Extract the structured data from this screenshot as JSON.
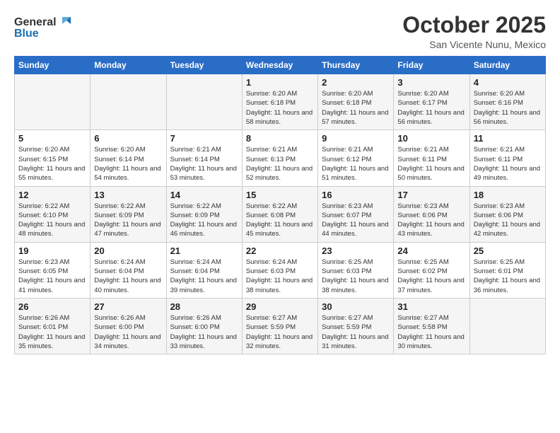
{
  "header": {
    "logo_line1": "General",
    "logo_line2": "Blue",
    "month": "October 2025",
    "location": "San Vicente Nunu, Mexico"
  },
  "weekdays": [
    "Sunday",
    "Monday",
    "Tuesday",
    "Wednesday",
    "Thursday",
    "Friday",
    "Saturday"
  ],
  "weeks": [
    [
      {
        "day": "",
        "sunrise": "",
        "sunset": "",
        "daylight": ""
      },
      {
        "day": "",
        "sunrise": "",
        "sunset": "",
        "daylight": ""
      },
      {
        "day": "",
        "sunrise": "",
        "sunset": "",
        "daylight": ""
      },
      {
        "day": "1",
        "sunrise": "Sunrise: 6:20 AM",
        "sunset": "Sunset: 6:18 PM",
        "daylight": "Daylight: 11 hours and 58 minutes."
      },
      {
        "day": "2",
        "sunrise": "Sunrise: 6:20 AM",
        "sunset": "Sunset: 6:18 PM",
        "daylight": "Daylight: 11 hours and 57 minutes."
      },
      {
        "day": "3",
        "sunrise": "Sunrise: 6:20 AM",
        "sunset": "Sunset: 6:17 PM",
        "daylight": "Daylight: 11 hours and 56 minutes."
      },
      {
        "day": "4",
        "sunrise": "Sunrise: 6:20 AM",
        "sunset": "Sunset: 6:16 PM",
        "daylight": "Daylight: 11 hours and 56 minutes."
      }
    ],
    [
      {
        "day": "5",
        "sunrise": "Sunrise: 6:20 AM",
        "sunset": "Sunset: 6:15 PM",
        "daylight": "Daylight: 11 hours and 55 minutes."
      },
      {
        "day": "6",
        "sunrise": "Sunrise: 6:20 AM",
        "sunset": "Sunset: 6:14 PM",
        "daylight": "Daylight: 11 hours and 54 minutes."
      },
      {
        "day": "7",
        "sunrise": "Sunrise: 6:21 AM",
        "sunset": "Sunset: 6:14 PM",
        "daylight": "Daylight: 11 hours and 53 minutes."
      },
      {
        "day": "8",
        "sunrise": "Sunrise: 6:21 AM",
        "sunset": "Sunset: 6:13 PM",
        "daylight": "Daylight: 11 hours and 52 minutes."
      },
      {
        "day": "9",
        "sunrise": "Sunrise: 6:21 AM",
        "sunset": "Sunset: 6:12 PM",
        "daylight": "Daylight: 11 hours and 51 minutes."
      },
      {
        "day": "10",
        "sunrise": "Sunrise: 6:21 AM",
        "sunset": "Sunset: 6:11 PM",
        "daylight": "Daylight: 11 hours and 50 minutes."
      },
      {
        "day": "11",
        "sunrise": "Sunrise: 6:21 AM",
        "sunset": "Sunset: 6:11 PM",
        "daylight": "Daylight: 11 hours and 49 minutes."
      }
    ],
    [
      {
        "day": "12",
        "sunrise": "Sunrise: 6:22 AM",
        "sunset": "Sunset: 6:10 PM",
        "daylight": "Daylight: 11 hours and 48 minutes."
      },
      {
        "day": "13",
        "sunrise": "Sunrise: 6:22 AM",
        "sunset": "Sunset: 6:09 PM",
        "daylight": "Daylight: 11 hours and 47 minutes."
      },
      {
        "day": "14",
        "sunrise": "Sunrise: 6:22 AM",
        "sunset": "Sunset: 6:09 PM",
        "daylight": "Daylight: 11 hours and 46 minutes."
      },
      {
        "day": "15",
        "sunrise": "Sunrise: 6:22 AM",
        "sunset": "Sunset: 6:08 PM",
        "daylight": "Daylight: 11 hours and 45 minutes."
      },
      {
        "day": "16",
        "sunrise": "Sunrise: 6:23 AM",
        "sunset": "Sunset: 6:07 PM",
        "daylight": "Daylight: 11 hours and 44 minutes."
      },
      {
        "day": "17",
        "sunrise": "Sunrise: 6:23 AM",
        "sunset": "Sunset: 6:06 PM",
        "daylight": "Daylight: 11 hours and 43 minutes."
      },
      {
        "day": "18",
        "sunrise": "Sunrise: 6:23 AM",
        "sunset": "Sunset: 6:06 PM",
        "daylight": "Daylight: 11 hours and 42 minutes."
      }
    ],
    [
      {
        "day": "19",
        "sunrise": "Sunrise: 6:23 AM",
        "sunset": "Sunset: 6:05 PM",
        "daylight": "Daylight: 11 hours and 41 minutes."
      },
      {
        "day": "20",
        "sunrise": "Sunrise: 6:24 AM",
        "sunset": "Sunset: 6:04 PM",
        "daylight": "Daylight: 11 hours and 40 minutes."
      },
      {
        "day": "21",
        "sunrise": "Sunrise: 6:24 AM",
        "sunset": "Sunset: 6:04 PM",
        "daylight": "Daylight: 11 hours and 39 minutes."
      },
      {
        "day": "22",
        "sunrise": "Sunrise: 6:24 AM",
        "sunset": "Sunset: 6:03 PM",
        "daylight": "Daylight: 11 hours and 38 minutes."
      },
      {
        "day": "23",
        "sunrise": "Sunrise: 6:25 AM",
        "sunset": "Sunset: 6:03 PM",
        "daylight": "Daylight: 11 hours and 38 minutes."
      },
      {
        "day": "24",
        "sunrise": "Sunrise: 6:25 AM",
        "sunset": "Sunset: 6:02 PM",
        "daylight": "Daylight: 11 hours and 37 minutes."
      },
      {
        "day": "25",
        "sunrise": "Sunrise: 6:25 AM",
        "sunset": "Sunset: 6:01 PM",
        "daylight": "Daylight: 11 hours and 36 minutes."
      }
    ],
    [
      {
        "day": "26",
        "sunrise": "Sunrise: 6:26 AM",
        "sunset": "Sunset: 6:01 PM",
        "daylight": "Daylight: 11 hours and 35 minutes."
      },
      {
        "day": "27",
        "sunrise": "Sunrise: 6:26 AM",
        "sunset": "Sunset: 6:00 PM",
        "daylight": "Daylight: 11 hours and 34 minutes."
      },
      {
        "day": "28",
        "sunrise": "Sunrise: 6:26 AM",
        "sunset": "Sunset: 6:00 PM",
        "daylight": "Daylight: 11 hours and 33 minutes."
      },
      {
        "day": "29",
        "sunrise": "Sunrise: 6:27 AM",
        "sunset": "Sunset: 5:59 PM",
        "daylight": "Daylight: 11 hours and 32 minutes."
      },
      {
        "day": "30",
        "sunrise": "Sunrise: 6:27 AM",
        "sunset": "Sunset: 5:59 PM",
        "daylight": "Daylight: 11 hours and 31 minutes."
      },
      {
        "day": "31",
        "sunrise": "Sunrise: 6:27 AM",
        "sunset": "Sunset: 5:58 PM",
        "daylight": "Daylight: 11 hours and 30 minutes."
      },
      {
        "day": "",
        "sunrise": "",
        "sunset": "",
        "daylight": ""
      }
    ]
  ]
}
